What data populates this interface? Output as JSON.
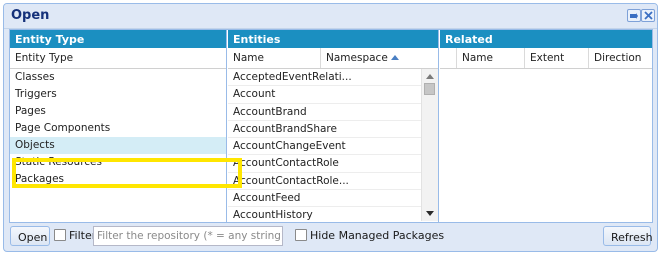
{
  "window": {
    "title": "Open",
    "pin_icon": "pin-icon",
    "close_icon": "close-icon"
  },
  "entity_type_panel": {
    "header": "Entity Type",
    "column": "Entity Type",
    "items": [
      "Classes",
      "Triggers",
      "Pages",
      "Page Components",
      "Objects",
      "Static Resources",
      "Packages"
    ],
    "selected_index": 4
  },
  "entities_panel": {
    "header": "Entities",
    "columns": [
      "Name",
      "Namespace"
    ],
    "sort_icon": "sort-ascending-icon",
    "items": [
      "AcceptedEventRelati...",
      "Account",
      "AccountBrand",
      "AccountBrandShare",
      "AccountChangeEvent",
      "AccountContactRole",
      "AccountContactRole...",
      "AccountFeed",
      "AccountHistory"
    ]
  },
  "related_panel": {
    "header": "Related",
    "columns": [
      "Name",
      "Extent",
      "Direction"
    ]
  },
  "toolbar": {
    "open_label": "Open",
    "filter_label": "Filter",
    "filter_placeholder": "Filter the repository (* = any string)",
    "hide_managed_label": "Hide Managed Packages",
    "refresh_label": "Refresh"
  },
  "colors": {
    "header_blue": "#1b8fc1",
    "selection": "#d4edf6",
    "highlight": "#ffe600"
  }
}
